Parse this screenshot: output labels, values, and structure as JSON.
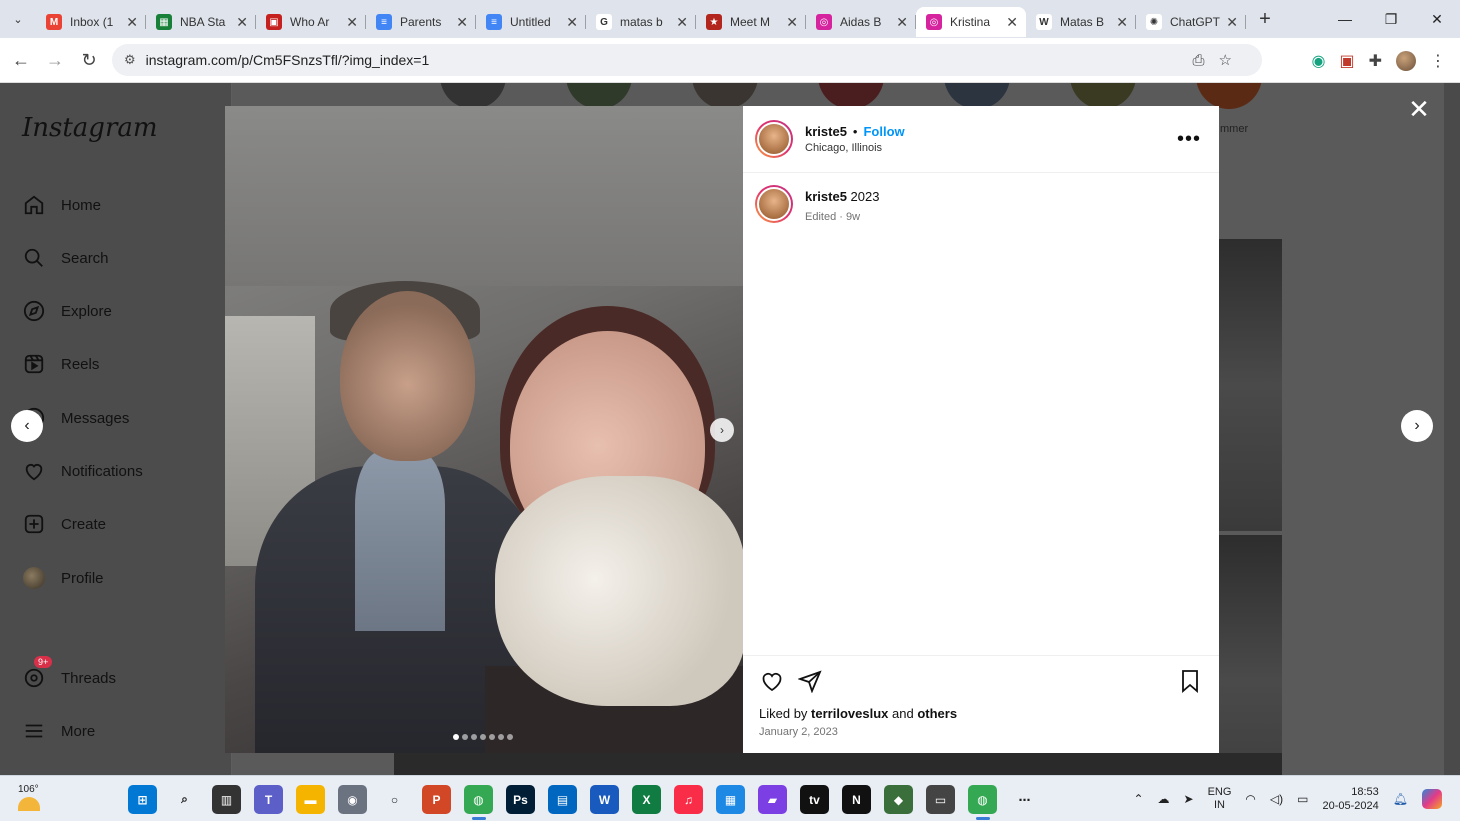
{
  "browser": {
    "tabs": [
      {
        "title": "Inbox (1",
        "icon": "gmail-icon",
        "color": "#ea4335",
        "glyph": "M"
      },
      {
        "title": "NBA Sta",
        "icon": "sheets-icon",
        "color": "#188038",
        "glyph": "▦"
      },
      {
        "title": "Who Ar",
        "icon": "site-icon",
        "color": "#c5221f",
        "glyph": "▣"
      },
      {
        "title": "Parents",
        "icon": "docs-icon",
        "color": "#4285f4",
        "glyph": "≡"
      },
      {
        "title": "Untitled",
        "icon": "docs-icon",
        "color": "#4285f4",
        "glyph": "≡"
      },
      {
        "title": "matas b",
        "icon": "google-icon",
        "color": "#ffffff",
        "glyph": "G"
      },
      {
        "title": "Meet M",
        "icon": "star-site-icon",
        "color": "#b3261e",
        "glyph": "★"
      },
      {
        "title": "Aidas B",
        "icon": "instagram-icon",
        "color": "#d6249f",
        "glyph": "◎"
      },
      {
        "title": "Kristina",
        "icon": "instagram-icon",
        "color": "#d6249f",
        "glyph": "◎",
        "active": true
      },
      {
        "title": "Matas B",
        "icon": "wikipedia-icon",
        "color": "#ffffff",
        "glyph": "W"
      },
      {
        "title": "ChatGPT",
        "icon": "chatgpt-icon",
        "color": "#ffffff",
        "glyph": "✺"
      }
    ],
    "url": "instagram.com/p/Cm5FSnzsTfl/?img_index=1"
  },
  "sidebar": {
    "logo": "Instagram",
    "items": [
      {
        "label": "Home",
        "icon": "home-icon"
      },
      {
        "label": "Search",
        "icon": "search-icon"
      },
      {
        "label": "Explore",
        "icon": "compass-icon"
      },
      {
        "label": "Reels",
        "icon": "reels-icon"
      },
      {
        "label": "Messages",
        "icon": "messenger-icon"
      },
      {
        "label": "Notifications",
        "icon": "heart-icon"
      },
      {
        "label": "Create",
        "icon": "plus-square-icon"
      },
      {
        "label": "Profile",
        "icon": "profile-avatar"
      },
      {
        "label": "Threads",
        "icon": "threads-icon",
        "badge": "9+"
      },
      {
        "label": "More",
        "icon": "menu-icon"
      }
    ]
  },
  "background": {
    "story_caption": "mmer"
  },
  "post": {
    "username": "kriste5",
    "follow_label": "Follow",
    "separator": "•",
    "location": "Chicago, Illinois",
    "caption": "2023",
    "caption_meta": "Edited · 9w",
    "liked_by_prefix": "Liked by",
    "liked_by_user": "terriloveslux",
    "liked_by_and": "and",
    "liked_by_others": "others",
    "date": "January 2, 2023",
    "carousel_count": 7,
    "carousel_index": 1
  },
  "taskbar": {
    "weather": "106°",
    "apps": [
      {
        "name": "windows-start-icon",
        "color": "#0078d4",
        "glyph": "⊞"
      },
      {
        "name": "search-icon",
        "color": "#e9eef5",
        "glyph": "⌕"
      },
      {
        "name": "taskview-icon",
        "color": "#333333",
        "glyph": "▥"
      },
      {
        "name": "teams-icon",
        "color": "#5b5fc7",
        "glyph": "T"
      },
      {
        "name": "file-explorer-icon",
        "color": "#f5b400",
        "glyph": "▬"
      },
      {
        "name": "camera-icon",
        "color": "#6b7280",
        "glyph": "◉"
      },
      {
        "name": "cortana-icon",
        "color": "#e9eef5",
        "glyph": "○"
      },
      {
        "name": "powerpoint-icon",
        "color": "#d24726",
        "glyph": "P"
      },
      {
        "name": "chrome-icon",
        "color": "#34a853",
        "glyph": "◍"
      },
      {
        "name": "photoshop-icon",
        "color": "#001e36",
        "glyph": "Ps"
      },
      {
        "name": "store-icon",
        "color": "#0067c0",
        "glyph": "▤"
      },
      {
        "name": "word-icon",
        "color": "#185abd",
        "glyph": "W"
      },
      {
        "name": "excel-icon",
        "color": "#107c41",
        "glyph": "X"
      },
      {
        "name": "music-icon",
        "color": "#fa2d48",
        "glyph": "♫"
      },
      {
        "name": "calculator-icon",
        "color": "#1e88e5",
        "glyph": "▦"
      },
      {
        "name": "clipchamp-icon",
        "color": "#7b3fe4",
        "glyph": "▰"
      },
      {
        "name": "appletv-icon",
        "color": "#111111",
        "glyph": "tv"
      },
      {
        "name": "netflix-icon",
        "color": "#111111",
        "glyph": "N"
      },
      {
        "name": "game-icon",
        "color": "#3a6e3a",
        "glyph": "◆"
      },
      {
        "name": "printer-icon",
        "color": "#444444",
        "glyph": "▭"
      },
      {
        "name": "chrome-profile-icon",
        "color": "#34a853",
        "glyph": "◍"
      },
      {
        "name": "overflow-icon",
        "color": "#e9eef5",
        "glyph": "⋯"
      }
    ],
    "language": "ENG",
    "region": "IN",
    "time": "18:53",
    "date": "20-05-2024"
  }
}
